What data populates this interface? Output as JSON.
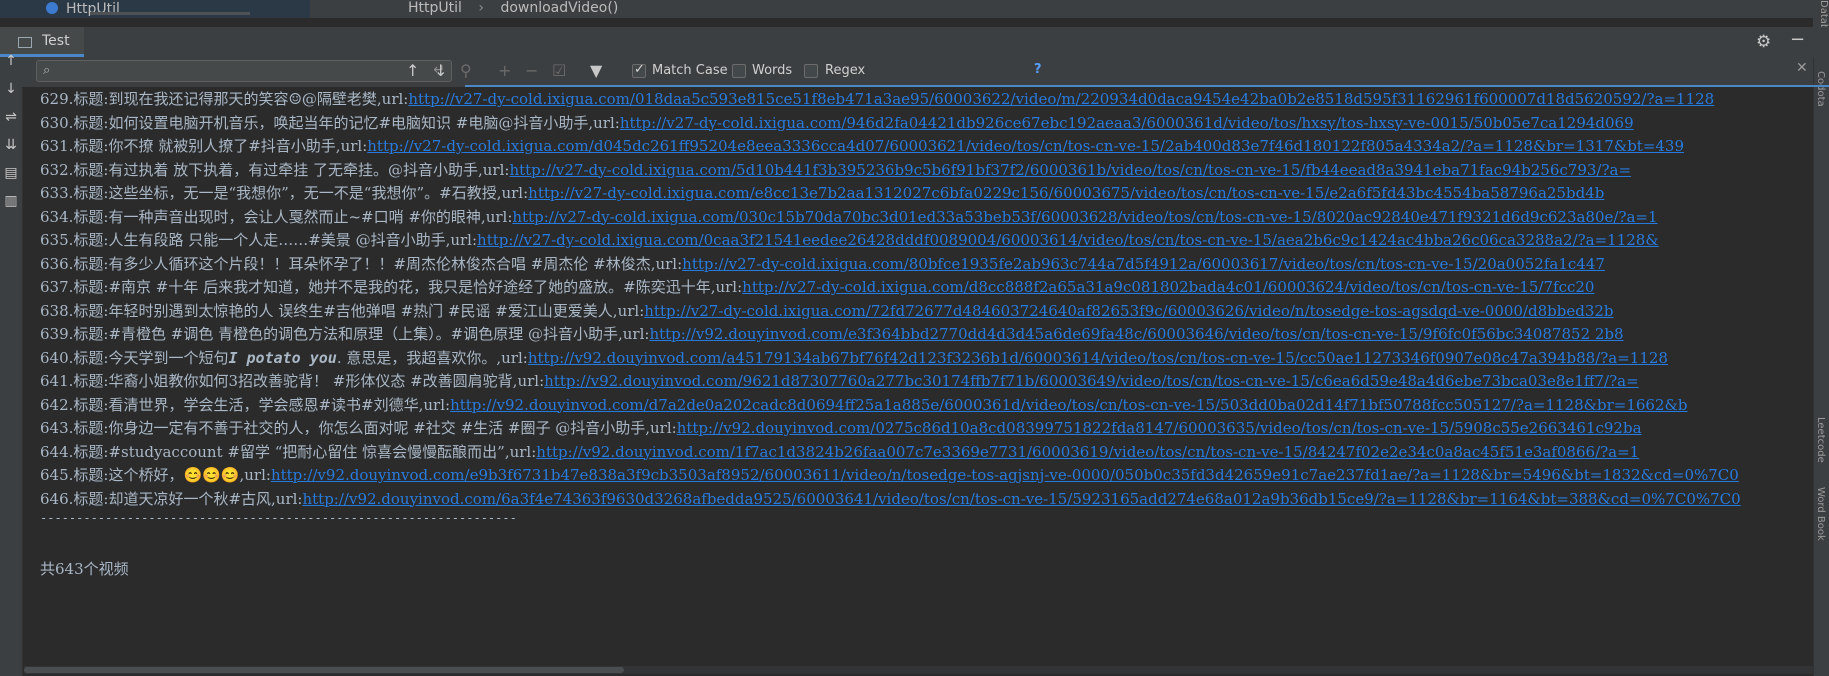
{
  "editor": {
    "tab_label": "HttpUtil",
    "breadcrumb": [
      "HttpUtil",
      "downloadVideo()"
    ]
  },
  "run_window": {
    "tab_label": "Test"
  },
  "right_strip": [
    "Codota",
    "Database",
    "Ant",
    "Leetcode",
    "Word Book"
  ],
  "find_bar": {
    "query": "",
    "match_case_label": "Match Case",
    "match_case_checked": true,
    "words_label": "Words",
    "words_checked": false,
    "regex_label": "Regex",
    "regex_checked": false,
    "help": "?"
  },
  "console": {
    "lines": [
      {
        "n": "629.",
        "prefix": "标题:到现在我还记得那天的笑容☺@隔壁老樊,url:",
        "url": "http://v27-dy-cold.ixigua.com/018daa5c593e815ce51f8eb471a3ae95/60003622/video/m/220934d0daca9454e42ba0b2e8518d595f31162961f600007d18d5620592/?a=1128"
      },
      {
        "n": "630.",
        "prefix": "标题:如何设置电脑开机音乐，唤起当年的记忆#电脑知识 #电脑@抖音小助手,url:",
        "url": "http://v27-dy-cold.ixigua.com/946d2fa04421db926ce67ebc192aeaa3/6000361d/video/tos/hxsy/tos-hxsy-ve-0015/50b05e7ca1294d069"
      },
      {
        "n": "631.",
        "prefix": "标题:你不撩 就被别人撩了#抖音小助手,url:",
        "url": "http://v27-dy-cold.ixigua.com/d045dc261ff95204e8eea3336cca4d07/60003621/video/tos/cn/tos-cn-ve-15/2ab400d83e7f46d180122f805a4334a2/?a=1128&br=1317&bt=439"
      },
      {
        "n": "632.",
        "prefix": "标题:有过执着 放下执着，有过牵挂 了无牵挂。@抖音小助手,url:",
        "url": "http://v27-dy-cold.ixigua.com/5d10b441f3b395236b9c5b6f91bf37f2/6000361b/video/tos/cn/tos-cn-ve-15/fb44eead8a3941eba71fac94b256c793/?a="
      },
      {
        "n": "633.",
        "prefix": "标题:这些坐标，无一是“我想你”，无一不是“我想你”。#石教授,url:",
        "url": "http://v27-dy-cold.ixigua.com/e8cc13e7b2aa1312027c6bfa0229c156/60003675/video/tos/cn/tos-cn-ve-15/e2a6f5fd43bc4554ba58796a25bd4b"
      },
      {
        "n": "634.",
        "prefix": "标题:有一种声音出现时，会让人戛然而止~#口哨 #你的眼神,url:",
        "url": "http://v27-dy-cold.ixigua.com/030c15b70da70bc3d01ed33a53beb53f/60003628/video/tos/cn/tos-cn-ve-15/8020ac92840e471f9321d6d9c623a80e/?a=1"
      },
      {
        "n": "635.",
        "prefix": "标题:人生有段路 只能一个人走……#美景 @抖音小助手,url:",
        "url": "http://v27-dy-cold.ixigua.com/0caa3f21541eedee26428dddf0089004/60003614/video/tos/cn/tos-cn-ve-15/aea2b6c9c1424ac4bba26c06ca3288a2/?a=1128&"
      },
      {
        "n": "636.",
        "prefix": "标题:有多少人循环这个片段！！耳朵怀孕了！！#周杰伦林俊杰合唱 #周杰伦 #林俊杰,url:",
        "url": "http://v27-dy-cold.ixigua.com/80bfce1935fe2ab963c744a7d5f4912a/60003617/video/tos/cn/tos-cn-ve-15/20a0052fa1c447"
      },
      {
        "n": "637.",
        "prefix": "标题:#南京 #十年 后来我才知道，她并不是我的花，我只是恰好途经了她的盛放。#陈奕迅十年,url:",
        "url": "http://v27-dy-cold.ixigua.com/d8cc888f2a65a31a9c081802bada4c01/60003624/video/tos/cn/tos-cn-ve-15/7fcc20"
      },
      {
        "n": "638.",
        "prefix": "标题:年轻时别遇到太惊艳的人  误终生#吉他弹唱 #热门 #民谣 #爱江山更爱美人,url:",
        "url": "http://v27-dy-cold.ixigua.com/72fd72677d484603724640af82653f9c/60003626/video/n/tosedge-tos-agsdqd-ve-0000/d8bbed32b"
      },
      {
        "n": "639.",
        "prefix": "标题:#青橙色 #调色 青橙色的调色方法和原理（上集）。#调色原理 @抖音小助手,url:",
        "url": "http://v92.douyinvod.com/e3f364bbd2770dd4d3d45a6de69fa48c/60003646/video/tos/cn/tos-cn-ve-15/9f6fc0f56bc34087852 2b8"
      },
      {
        "n": "640.",
        "prefix": "标题:今天学到一个短句",
        "italic": "I potato you",
        "prefix2": ". 意思是，我超喜欢你。,url:",
        "url": "http://v92.douyinvod.com/a45179134ab67bf76f42d123f3236b1d/60003614/video/tos/cn/tos-cn-ve-15/cc50ae11273346f0907e08c47a394b88/?a=1128"
      },
      {
        "n": "641.",
        "prefix": "标题:华裔小姐教你如何3招改善驼背！ #形体仪态  #改善圆肩驼背,url:",
        "url": "http://v92.douyinvod.com/9621d87307760a277bc30174ffb7f71b/60003649/video/tos/cn/tos-cn-ve-15/c6ea6d59e48a4d6ebe73bca03e8e1ff7/?a="
      },
      {
        "n": "642.",
        "prefix": "标题:看清世界，学会生活，学会感恩#读书#刘德华,url:",
        "url": "http://v92.douyinvod.com/d7a2de0a202cadc8d0694ff25a1a885e/6000361d/video/tos/cn/tos-cn-ve-15/503dd0ba02d14f71bf50788fcc505127/?a=1128&br=1662&b"
      },
      {
        "n": "643.",
        "prefix": "标题:你身边一定有不善于社交的人，你怎么面对呢 #社交 #生活 #圈子 @抖音小助手,url:",
        "url": "http://v92.douyinvod.com/0275c86d10a8cd08399751822fda8147/60003635/video/tos/cn/tos-cn-ve-15/5908c55e2663461c92ba"
      },
      {
        "n": "644.",
        "prefix": "标题:#studyaccount #留学 “把耐心留住 惊喜会慢慢酝酿而出”,url:",
        "url": "http://v92.douyinvod.com/1f7ac1d3824b26faa007c7e3369e7731/60003619/video/tos/cn/tos-cn-ve-15/84247f02e2e34c0a8ac45f51e3af0866/?a=1"
      },
      {
        "n": "645.",
        "prefix": "标题:这个桥好，😊😊😊,url:",
        "url": "http://v92.douyinvod.com/e9b3f6731b47e838a3f9cb3503af8952/60003611/video/n/tosedge-tos-agjsnj-ve-0000/050b0c35fd3d42659e91c7ae237fd1ae/?a=1128&br=5496&bt=1832&cd=0%7C0"
      },
      {
        "n": "646.",
        "prefix": "标题:却道天凉好一个秋#古风,url:",
        "url": "http://v92.douyinvod.com/6a3f4e74363f9630d3268afbedda9525/60003641/video/tos/cn/tos-cn-ve-15/5923165add274e68a012a9b36db15ce9/?a=1128&br=1164&bt=388&cd=0%7C0%7C0"
      }
    ],
    "separator": "------------------------------------------------------------------",
    "total": "共643个视频"
  }
}
